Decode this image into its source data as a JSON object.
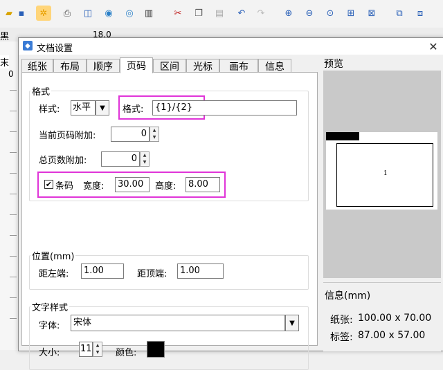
{
  "background_app": {
    "format_fontsize": "18.0",
    "format_frag_left": "黑",
    "side_frag": "末",
    "ruler_zero": "0",
    "toolbar_icons": [
      "open-folder-icon",
      "save-icon",
      "settings-gear-icon",
      "print-icon",
      "print-preview-icon",
      "database-icon",
      "database-link-icon",
      "barcode-icon",
      "cut-icon",
      "copy-icon",
      "paste-icon",
      "undo-icon",
      "redo-icon",
      "zoom-in-icon",
      "zoom-out-icon",
      "zoom-fit-icon",
      "zoom-full-icon",
      "zoom-page-icon",
      "group-icon",
      "ungroup-icon"
    ]
  },
  "dialog": {
    "title": "文档设置",
    "close_glyph": "✕",
    "tabs": [
      {
        "label": "纸张"
      },
      {
        "label": "布局"
      },
      {
        "label": "顺序"
      },
      {
        "label": "页码",
        "active": true
      },
      {
        "label": "区间"
      },
      {
        "label": "光标"
      },
      {
        "label": "画布"
      },
      {
        "label": "信息"
      }
    ],
    "format_group": {
      "title": "格式",
      "style_label": "样式:",
      "style_value": "水平",
      "format_label": "格式:",
      "format_value": "{1}/{2}",
      "current_page_label": "当前页码附加:",
      "current_page_value": "0",
      "total_pages_label": "总页数附加:",
      "total_pages_value": "0",
      "barcode_checked": true,
      "barcode_label": "条码",
      "width_label": "宽度:",
      "width_value": "30.00",
      "height_label": "高度:",
      "height_value": "8.00"
    },
    "position_group": {
      "title": "位置(mm)",
      "left_label": "距左端:",
      "left_value": "1.00",
      "top_label": "距顶端:",
      "top_value": "1.00"
    },
    "text_style_group": {
      "title": "文字样式",
      "font_label": "字体:",
      "font_value": "宋体",
      "size_label": "大小:",
      "size_value": "11",
      "color_label": "颜色:",
      "color_value": "#000000"
    },
    "preview": {
      "title": "预览",
      "page_number": "1"
    },
    "info": {
      "title": "信息(mm)",
      "paper_label": "纸张:",
      "paper_value": "100.00 x 70.00",
      "label_label": "标签:",
      "label_value": "87.00 x 57.00"
    },
    "highlight_color": "#e034d8"
  }
}
